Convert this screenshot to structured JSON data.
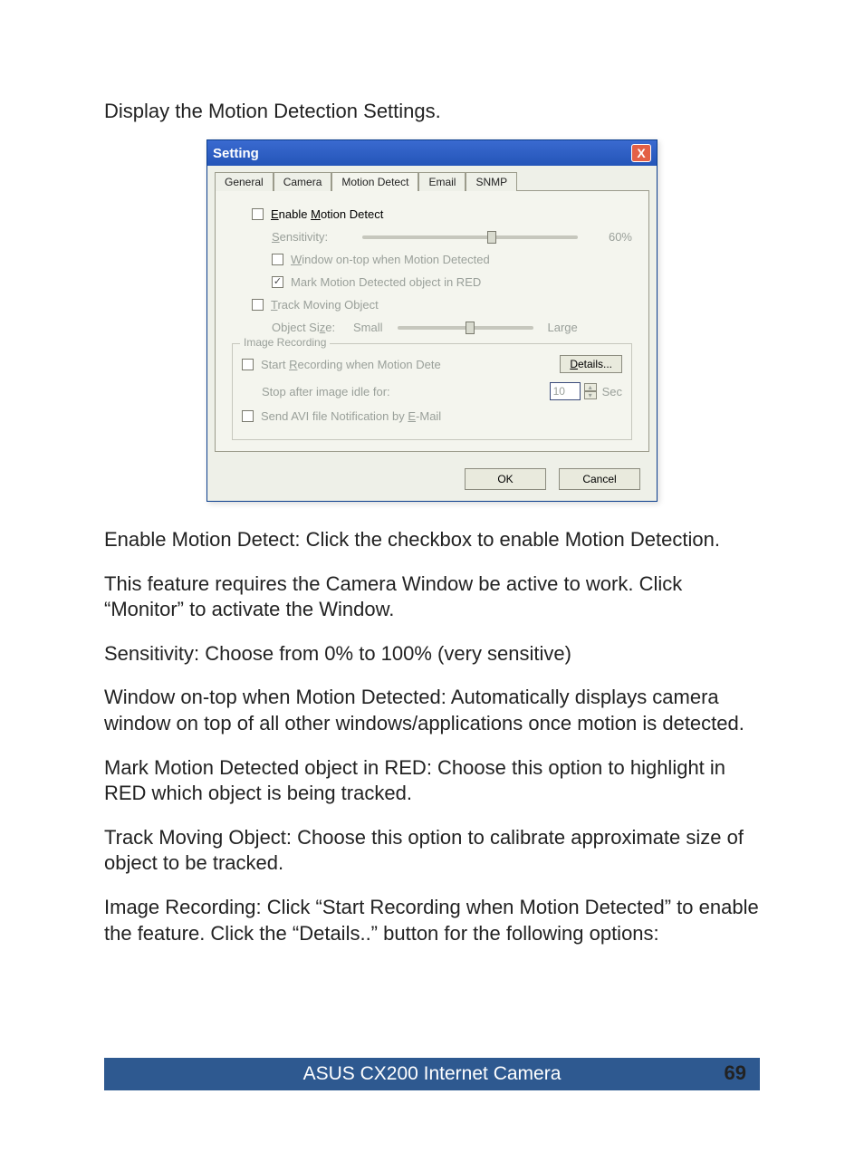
{
  "intro": "Display the Motion Detection Settings.",
  "dialog": {
    "title": "Setting",
    "close_label": "X",
    "tabs": {
      "general": "General",
      "camera": "Camera",
      "motion": "Motion Detect",
      "email": "Email",
      "snmp": "SNMP"
    },
    "enable_label": "Enable Motion Detect",
    "sensitivity_label": "Sensitivity:",
    "sensitivity_value": "60%",
    "window_on_top": "Window on-top when Motion Detected",
    "mark_red": "Mark Motion Detected object in RED",
    "track_moving": "Track Moving Object",
    "object_size_label": "Object Size:",
    "object_size_small": "Small",
    "object_size_large": "Large",
    "image_recording_legend": "Image Recording",
    "start_recording": "Start Recording when Motion Dete",
    "details_btn": "Details...",
    "stop_after_label": "Stop after image idle for:",
    "stop_after_value": "10",
    "stop_after_unit": "Sec",
    "send_avi": "Send AVI file Notification by E-Mail",
    "ok": "OK",
    "cancel": "Cancel"
  },
  "body": {
    "p1": "Enable Motion Detect: Click the checkbox to enable Motion Detection.",
    "p2": "This feature requires the Camera Window be active to work. Click “Monitor” to activate the Window.",
    "p3": "Sensitivity: Choose from 0% to 100% (very sensitive)",
    "p4": "Window on-top when Motion Detected: Automatically displays camera window on top of all other windows/applications once motion is detected.",
    "p5": "Mark Motion Detected object in RED: Choose this option to highlight in RED which object is being tracked.",
    "p6": "Track Moving Object: Choose this option to calibrate approximate size of object to be tracked.",
    "p7": "Image Recording: Click “Start Recording when Motion Detected” to enable the feature. Click the “Details..” button for the following options:"
  },
  "footer": "ASUS CX200 Internet Camera",
  "page": "69"
}
